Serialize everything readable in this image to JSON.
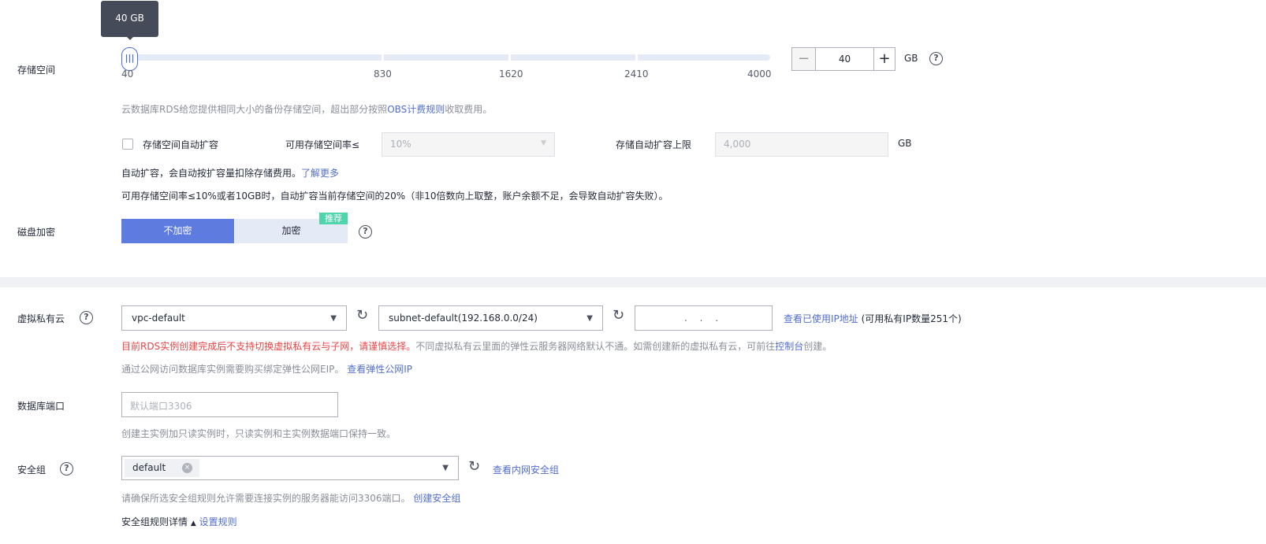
{
  "storage": {
    "label": "存储空间",
    "tooltip": "40 GB",
    "ticks": [
      "40",
      "830",
      "1620",
      "2410",
      "4000"
    ],
    "value": "40",
    "unit": "GB",
    "slider_fraction": 0,
    "note_pre": "云数据库RDS给您提供相同大小的备份存储空间，超出部分按照",
    "note_link": "OBS计费规则",
    "note_post": "收取费用。",
    "auto_label": "存储空间自动扩容",
    "rate_label": "可用存储空间率≤",
    "rate_value": "10%",
    "limit_label": "存储自动扩容上限",
    "limit_value": "4,000",
    "limit_unit": "GB",
    "auto_note": "自动扩容，会自动按扩容量扣除存储费用。",
    "auto_link": "了解更多",
    "auto_note2": "可用存储空间率≤10%或者10GB时，自动扩容当前存储空间的20%（非10倍数向上取整，账户余额不足，会导致自动扩容失败）。"
  },
  "encrypt": {
    "label": "磁盘加密",
    "off": "不加密",
    "on": "加密",
    "badge": "推荐"
  },
  "vpc": {
    "label": "虚拟私有云",
    "vpc_value": "vpc-default",
    "subnet_value": "subnet-default(192.168.0.0/24)",
    "ip_placeholder": ".   .   .",
    "ip_link": "查看已使用IP地址",
    "ip_count": "(可用私有IP数量251个)",
    "warn": "目前RDS实例创建完成后不支持切换虚拟私有云与子网，请谨慎选择。",
    "note": "不同虚拟私有云里面的弹性云服务器网络默认不通。如需创建新的虚拟私有云，可前往",
    "console_link": "控制台",
    "note_end": "创建。",
    "eip_note": "通过公网访问数据库实例需要购买绑定弹性公网EIP。",
    "eip_link": "查看弹性公网IP"
  },
  "port": {
    "label": "数据库端口",
    "placeholder": "默认端口3306",
    "note": "创建主实例加只读实例时，只读实例和主实例数据端口保持一致。"
  },
  "sg": {
    "label": "安全组",
    "tag": "default",
    "link": "查看内网安全组",
    "note": "请确保所选安全组规则允许需要连接实例的服务器能访问3306端口。",
    "create_link": "创建安全组",
    "details": "安全组规则详情",
    "rules_link": "设置规则"
  }
}
